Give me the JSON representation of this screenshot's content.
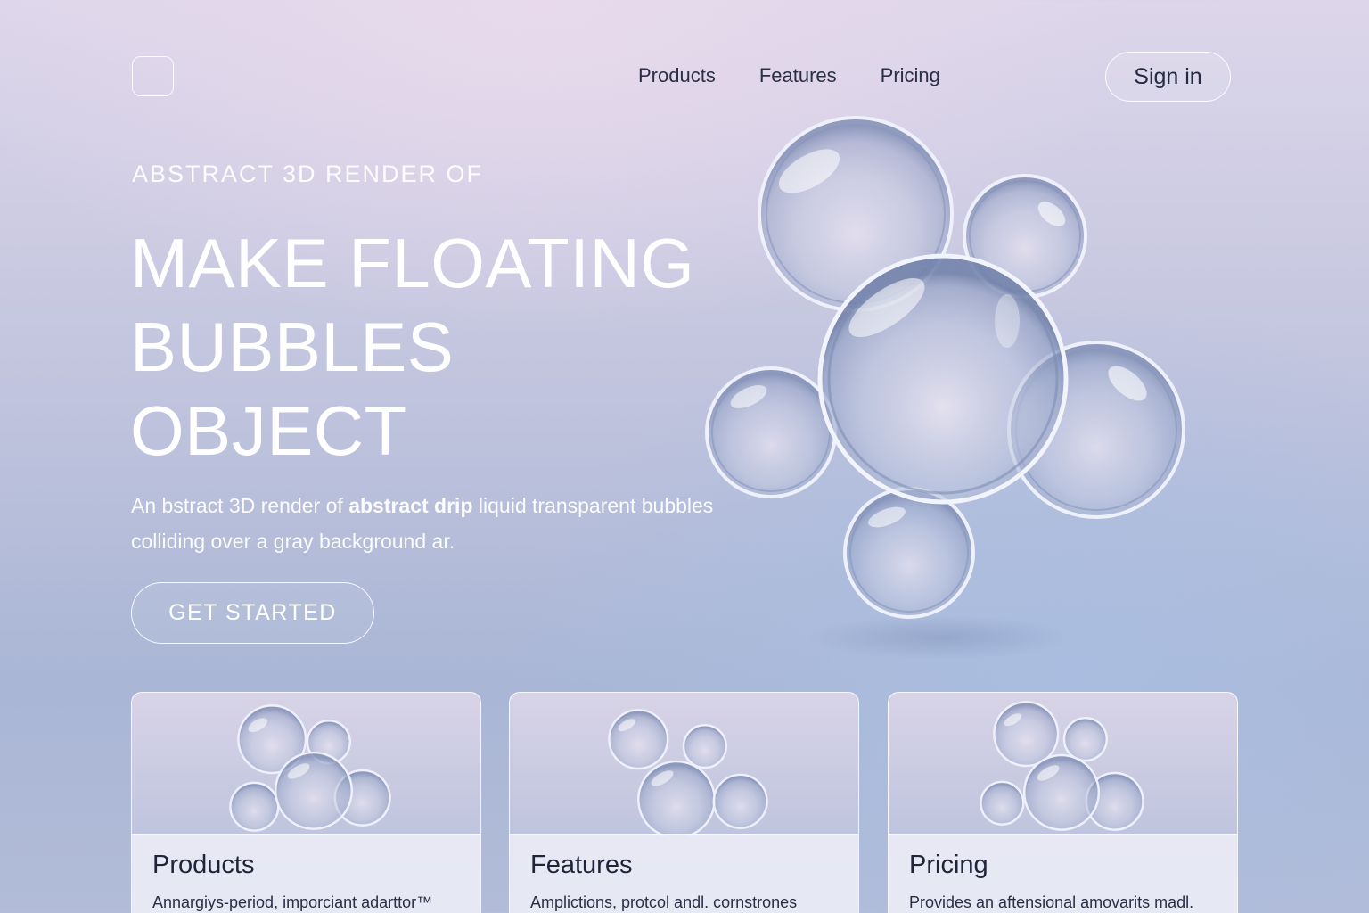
{
  "header": {
    "logo_icon": "rounded-square-logo",
    "nav": [
      {
        "label": "Products"
      },
      {
        "label": "Features"
      },
      {
        "label": "Pricing"
      }
    ],
    "signin_label": "Sign in"
  },
  "hero": {
    "eyebrow": "ABSTRACT 3D RENDER OF",
    "headline_lines": [
      "MAKE FLOATING",
      "BUBBLES",
      "OBJECT"
    ],
    "desc_prefix": "An bstract 3D render of ",
    "desc_bold": "abstract drip",
    "desc_suffix": " liquid transparent bubbles colliding over a gray background ar.",
    "cta_label": "GET STARTED"
  },
  "cards": [
    {
      "title": "Products",
      "text": "Annargiys-period, imporciant adarttor™"
    },
    {
      "title": "Features",
      "text": "Amplictions, protcol andl. cornstrones"
    },
    {
      "title": "Pricing",
      "text": "Provides an aftensional amovarits madl."
    }
  ],
  "colors": {
    "accent_text": "#ffffff",
    "dark_text": "#252a40",
    "bubble_tint": "#c6cde4"
  }
}
